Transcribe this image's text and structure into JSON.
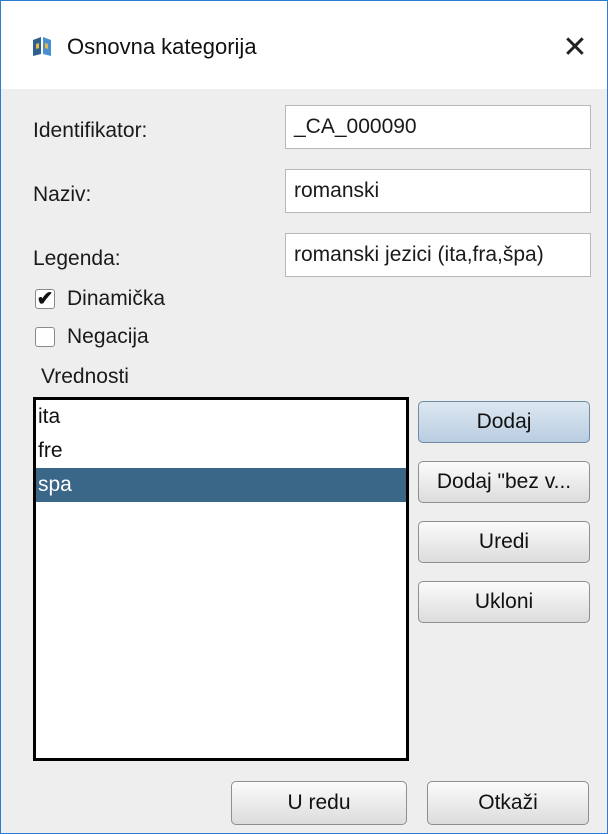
{
  "window": {
    "title": "Osnovna kategorija",
    "close_glyph": "✕"
  },
  "form": {
    "identifier": {
      "label": "Identifikator:",
      "value": "_CA_000090"
    },
    "name": {
      "label": "Naziv:",
      "value": "romanski"
    },
    "legend": {
      "label": "Legenda:",
      "value": "romanski jezici (ita,fra,špa)"
    }
  },
  "checks": {
    "dynamic": {
      "label": "Dinamička",
      "checked": true,
      "mark": "✔"
    },
    "negation": {
      "label": "Negacija",
      "checked": false,
      "mark": ""
    }
  },
  "values": {
    "label": "Vrednosti",
    "items": [
      {
        "text": "ita",
        "selected": false
      },
      {
        "text": "fre",
        "selected": false
      },
      {
        "text": "spa",
        "selected": true
      }
    ]
  },
  "buttons": {
    "add": "Dodaj",
    "add_without": "Dodaj \"bez v...",
    "edit": "Uredi",
    "remove": "Ukloni",
    "ok": "U redu",
    "cancel": "Otkaži"
  },
  "colors": {
    "selection": "#3a6688",
    "window_border": "#2b7fd0"
  }
}
